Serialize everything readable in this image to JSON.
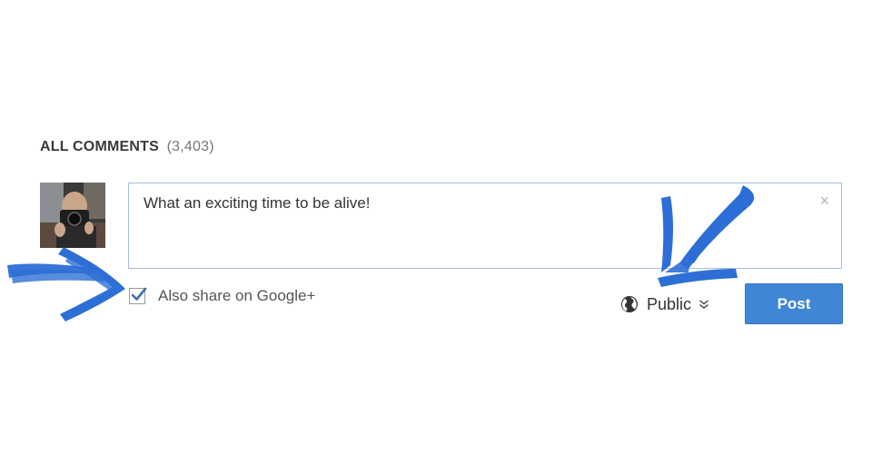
{
  "comments": {
    "title": "ALL COMMENTS",
    "count": "(3,403)"
  },
  "composer": {
    "text": "What an exciting time to be alive!",
    "close_icon": "×",
    "share_label": "Also share on Google+",
    "share_checked": true,
    "privacy_label": "Public",
    "post_label": "Post"
  },
  "icons": {
    "globe": "globe-icon",
    "chevron": "double-chevron-down-icon",
    "check": "check-icon",
    "close": "close-icon"
  },
  "colors": {
    "post_button": "#3f86d6",
    "annotation_arrows": "#2d6fd6",
    "box_border": "#a7bde0"
  }
}
